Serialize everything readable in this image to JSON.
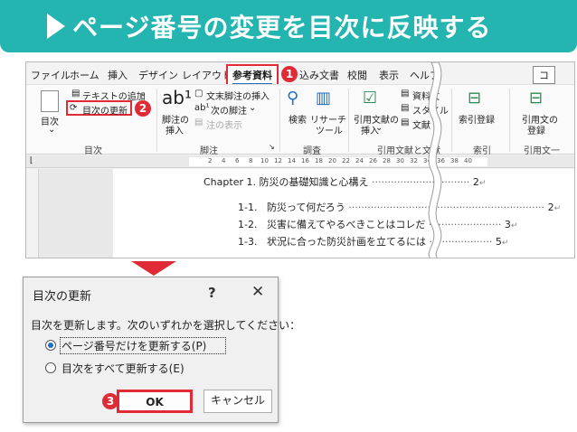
{
  "banner": {
    "title": "ページ番号の変更を目次に反映する"
  },
  "word": {
    "tabs": [
      "ファイル",
      "ホーム",
      "挿入",
      "デザイン",
      "レイアウト",
      "参考資料",
      "込み文書",
      "校閲",
      "表示",
      "ヘルプ"
    ],
    "tab_partial": "コ",
    "ribbon": {
      "toc_button": "目次",
      "add_text": "テキストの追加",
      "update_toc": "目次の更新",
      "group_toc": "目次",
      "footnote_button_top": "脚注の",
      "footnote_button_bottom": "挿入",
      "insert_endnote": "文末脚注の挿入",
      "next_footnote": "次の脚注",
      "show_notes": "注の表示",
      "group_footnotes": "脚注",
      "search": "検索",
      "researcher_top": "リサーチ",
      "researcher_bottom": "ツール",
      "group_research": "調査",
      "insert_citation_top": "引用文献の",
      "insert_citation_bottom": "挿入",
      "manage_sources": "資料文",
      "style": "スタイル",
      "bibliography": "文献",
      "group_citations": "引用文献と文献",
      "mark_entry": "索引登録",
      "group_index": "索引",
      "mark_citation_top": "引用文の",
      "mark_citation_bottom": "登録",
      "group_toa": "引用文一"
    },
    "ruler_numbers": [
      "2",
      "4",
      "6",
      "8",
      "10",
      "12",
      "14",
      "16",
      "18",
      "20",
      "22",
      "24",
      "26",
      "28",
      "30",
      "32",
      "34",
      "36",
      "38",
      "40"
    ],
    "toc": [
      {
        "num": "Chapter 1.",
        "text": "防災の基礎知識と心構え",
        "page": "2"
      },
      {
        "num": "1-1.",
        "text": "防災って何だろう",
        "page": "2"
      },
      {
        "num": "1-2.",
        "text": "災害に備えてやるべきことはコレだ",
        "page": "3"
      },
      {
        "num": "1-3.",
        "text": "状況に合った防災計画を立てるには",
        "page": "5"
      }
    ]
  },
  "dialog": {
    "title": "目次の更新",
    "help": "?",
    "close": "✕",
    "message": "目次を更新します。次のいずれかを選択してください：",
    "option1": "ページ番号だけを更新する(P)",
    "option2": "目次をすべて更新する(E)",
    "ok": "OK",
    "cancel": "キャンセル"
  },
  "steps": [
    "1",
    "2",
    "3"
  ],
  "colors": {
    "banner": "#24b5b0",
    "highlight": "#e02b36",
    "accent": "#1e6fc8"
  }
}
